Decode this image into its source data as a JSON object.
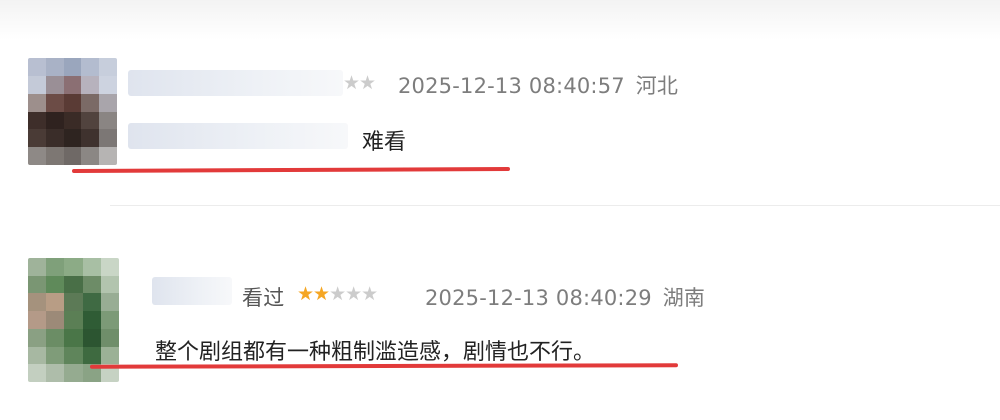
{
  "comments": [
    {
      "stars": "★★",
      "timestamp": "2025-12-13 08:40:57",
      "location": "河北",
      "text": "难看"
    },
    {
      "status": "看过",
      "stars_on": "★★",
      "stars_off": "★★★",
      "rating": 2,
      "timestamp": "2025-12-13 08:40:29",
      "location": "湖南",
      "text": "整个剧组都有一种粗制滥造感，剧情也不行。"
    }
  ],
  "colors": {
    "underline": "#e23a3a",
    "star_filled": "#f5a623",
    "star_empty": "#cccccc",
    "meta_text": "#7d7d7d"
  }
}
